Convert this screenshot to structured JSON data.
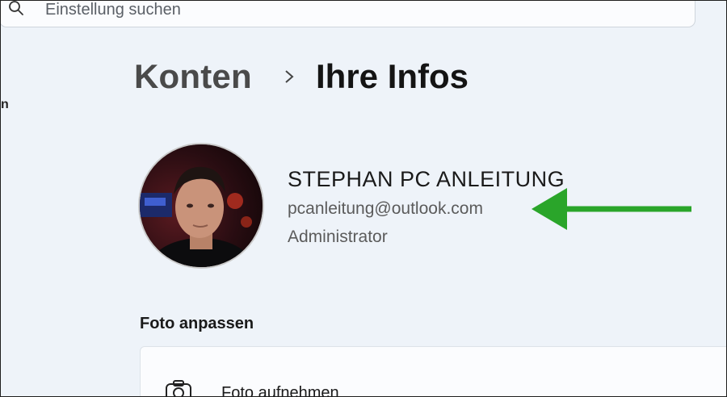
{
  "search": {
    "placeholder": "Einstellung suchen"
  },
  "sidebar": {
    "partial_label": "n"
  },
  "breadcrumb": {
    "parent": "Konten",
    "current": "Ihre Infos"
  },
  "user": {
    "name": "STEPHAN PC ANLEITUNG",
    "email": "pcanleitung@outlook.com",
    "role": "Administrator"
  },
  "photo_section": {
    "heading": "Foto anpassen",
    "take_photo_label": "Foto aufnehmen"
  },
  "colors": {
    "annotation_arrow": "#2aa52a",
    "background": "#eef3f9"
  },
  "icons": [
    "search-icon",
    "chevron-right-icon",
    "camera-icon"
  ]
}
